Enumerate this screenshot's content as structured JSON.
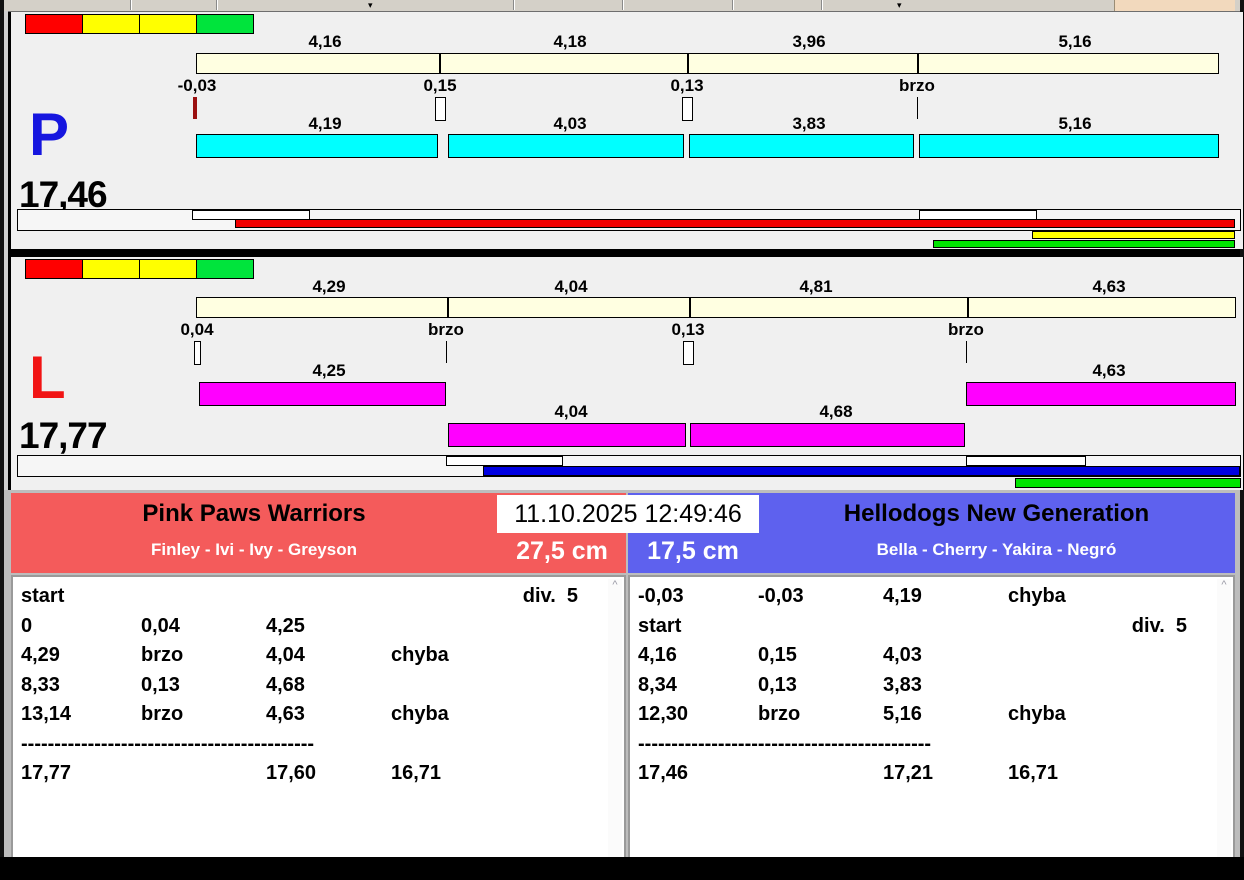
{
  "window": {
    "timestamp": "11.10.2025 12:49:46"
  },
  "traffic_light": {
    "colors": [
      "#ff0000",
      "#ffff00",
      "#ffff00",
      "#00e43c"
    ]
  },
  "lanes": [
    {
      "letter": "P",
      "total": "17,46",
      "colors": {
        "letter": "#1616df",
        "scale": "#ffffe1",
        "bar": "#00ffff"
      },
      "top_segments": [
        "4,16",
        "4,18",
        "3,96",
        "5,16"
      ],
      "markers": [
        {
          "label": "-0,03",
          "type": "red-tick"
        },
        {
          "label": "0,15",
          "type": "box"
        },
        {
          "label": "0,13",
          "type": "box"
        },
        {
          "label": "brzo",
          "type": "tick"
        }
      ],
      "bottom_segments": [
        "4,19",
        "4,03",
        "3,83",
        "5,16"
      ],
      "progress": {
        "box": "#ffffff",
        "run_bar": "#f20000",
        "aux1": "#ffff00",
        "aux2": "#00e400"
      }
    },
    {
      "letter": "L",
      "total": "17,77",
      "colors": {
        "letter": "#f11414",
        "scale": "#ffffe1",
        "bar": "#ff00ff"
      },
      "top_segments": [
        "4,29",
        "4,04",
        "4,81",
        "4,63"
      ],
      "markers": [
        {
          "label": "0,04",
          "type": "slim-box"
        },
        {
          "label": "brzo",
          "type": "tick"
        },
        {
          "label": "0,13",
          "type": "box"
        },
        {
          "label": "brzo",
          "type": "tick"
        }
      ],
      "bottom_segments": [
        "4,25",
        "4,04",
        "4,68",
        "4,63"
      ],
      "progress": {
        "box": "#ffffff",
        "run_bar": "#0000e2",
        "aux2": "#00e400"
      }
    }
  ],
  "teams": [
    {
      "name": "Pink Paws Warriors",
      "dogs": "Finley - Ivi - Ivy - Greyson",
      "height": "27,5 cm",
      "color": "#f45b5b",
      "log": [
        [
          "start",
          "",
          "",
          "",
          "div.  5"
        ],
        [
          "0",
          "0,04",
          "4,25",
          "",
          ""
        ],
        [
          "4,29",
          "brzo",
          "4,04",
          "chyba",
          ""
        ],
        [
          "8,33",
          "0,13",
          "4,68",
          "",
          ""
        ],
        [
          "13,14",
          "brzo",
          "4,63",
          "chyba",
          ""
        ],
        [
          "--------------------------------------------",
          "",
          "",
          "",
          ""
        ],
        [
          "17,77",
          "",
          "17,60",
          "16,71",
          ""
        ]
      ]
    },
    {
      "name": "Hellodogs New Generation",
      "dogs": "Bella - Cherry - Yakira - Negró",
      "height": "17,5 cm",
      "color": "#5e61ee",
      "log": [
        [
          "-0,03",
          "-0,03",
          "4,19",
          "chyba",
          ""
        ],
        [
          "start",
          "",
          "",
          "",
          "div.  5"
        ],
        [
          "4,16",
          "0,15",
          "4,03",
          "",
          ""
        ],
        [
          "8,34",
          "0,13",
          "3,83",
          "",
          ""
        ],
        [
          "12,30",
          "brzo",
          "5,16",
          "chyba",
          ""
        ],
        [
          "--------------------------------------------",
          "",
          "",
          "",
          ""
        ],
        [
          "17,46",
          "",
          "17,21",
          "16,71",
          ""
        ]
      ]
    }
  ]
}
